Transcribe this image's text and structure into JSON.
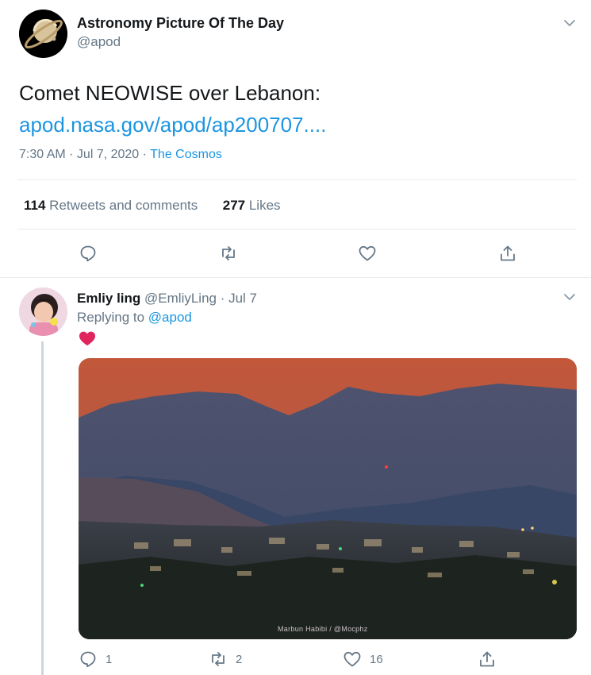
{
  "main_tweet": {
    "author_name": "Astronomy Picture Of The Day",
    "author_handle": "@apod",
    "text": "Comet NEOWISE over Lebanon:",
    "link": "apod.nasa.gov/apod/ap200707....",
    "time": "7:30 AM · Jul 7, 2020 · ",
    "source": "The Cosmos",
    "retweets_count": "114",
    "retweets_label": "Retweets and comments",
    "likes_count": "277",
    "likes_label": "Likes",
    "actions": [
      "reply-icon",
      "retweet-icon",
      "like-icon",
      "share-icon"
    ]
  },
  "reply": {
    "author_name": "Emliy ling",
    "author_handle_date": "@EmliyLing · Jul 7",
    "replying_prefix": "Replying to ",
    "replying_to": "@apod",
    "emoji": "heart",
    "photo_credit": "Marbun Habibi / @Mocphz",
    "reply_count": "1",
    "retweet_count": "2",
    "like_count": "16",
    "colors": {
      "heart": "#e0245e",
      "sky": "#b85a3f",
      "mountains": "#46506e"
    }
  },
  "colors": {
    "link": "#1b95e0",
    "muted": "#657786",
    "text": "#14171a",
    "divider": "#e6ecf0"
  }
}
